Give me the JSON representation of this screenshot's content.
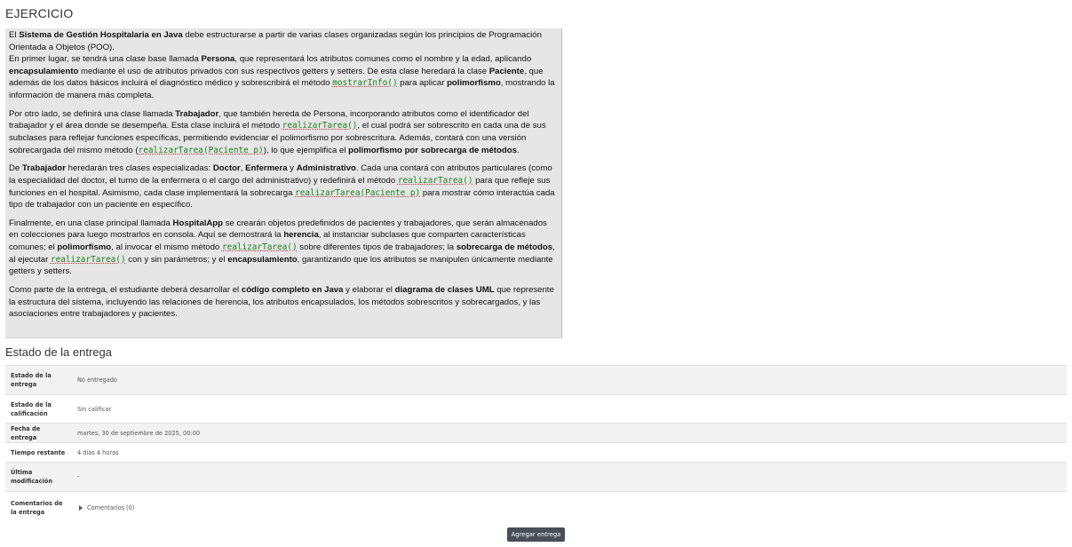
{
  "page": {
    "title": "EJERCICIO"
  },
  "exercise": {
    "p1": {
      "a": "El ",
      "b": "Sistema de Gestión Hospitalaria en Java",
      "c": " debe estructurarse a partir de varias clases organizadas según los principios de Programación Orientada a Objetos (POO).",
      "d": " En primer lugar, se tendrá una clase base llamada ",
      "e": "Persona",
      "f": ", que representará los atributos comunes como el nombre y la edad, aplicando ",
      "g": "encapsulamiento",
      "h": " mediante el uso de atributos privados con sus respectivos getters y setters. De esta clase heredará la clase ",
      "i": "Paciente",
      "j": ", que además de los datos básicos incluirá el diagnóstico médico y sobrescribirá el método ",
      "k": "mostrarInfo()",
      "l": " para aplicar ",
      "m": "polimorfismo",
      "n": ", mostrando la información de manera más completa."
    },
    "p2": {
      "a": "Por otro lado, se definirá una clase llamada ",
      "b": "Trabajador",
      "c": ", que también hereda de Persona, incorporando atributos como el identificador del trabajador y el área donde se desempeña. Esta clase incluirá el método ",
      "d": "realizarTarea()",
      "e": ", el cual podrá ser sobrescrito en cada una de sus subclases para reflejar funciones específicas, permitiendo evidenciar el polimorfismo por sobrescritura. Además, contará con una versión sobrecargada del mismo método (",
      "f": "realizarTarea(Paciente p)",
      "g": "), lo que ejemplifica el ",
      "h": "polimorfismo por sobrecarga de métodos",
      "i": "."
    },
    "p3": {
      "a": "De ",
      "b": "Trabajador",
      "c": " heredarán tres clases especializadas: ",
      "d": "Doctor",
      "e": ", ",
      "f": "Enfermera",
      "g": " y ",
      "h": "Administrativo",
      "i": ". Cada una contará con atributos particulares (como la especialidad del doctor, el turno de la enfermera o el cargo del administrativo) y redefinirá el método ",
      "j": "realizarTarea()",
      "k": " para que refleje sus funciones en el hospital. Asimismo, cada clase implementará la sobrecarga ",
      "l": "realizarTarea(Paciente p)",
      "m": " para mostrar cómo interactúa cada tipo de trabajador con un paciente en específico."
    },
    "p4": {
      "a": "Finalmente, en una clase principal llamada ",
      "b": "HospitalApp",
      "c": " se crearán objetos predefinidos de pacientes y trabajadores, que serán almacenados en colecciones para luego mostrarlos en consola. Aquí se demostrará la ",
      "d": "herencia",
      "e": ", al instanciar subclases que comparten características comunes; el ",
      "f": "polimorfismo",
      "g": ", al invocar el mismo método ",
      "h": "realizarTarea()",
      "i": " sobre diferentes tipos de trabajadores; la ",
      "j": "sobrecarga de métodos",
      "k": ", al ejecutar ",
      "l": "realizarTarea()",
      "m": " con y sin parámetros; y el ",
      "n": "encapsulamiento",
      "o": ", garantizando que los atributos se manipulen únicamente mediante getters y setters."
    },
    "p5": {
      "a": "Como parte de la entrega, el estudiante deberá desarrollar el ",
      "b": "código completo en Java",
      "c": " y elaborar el ",
      "d": "diagrama de clases UML",
      "e": " que represente la estructura del sistema, incluyendo las relaciones de herencia, los atributos encapsulados, los métodos sobrescritos y sobrecargados, y las asociaciones entre trabajadores y pacientes."
    }
  },
  "submission": {
    "title": "Estado de la entrega",
    "rows": [
      {
        "label": "Estado de la entrega",
        "value": "No entregado"
      },
      {
        "label": "Estado de la calificación",
        "value": "Sin calificar"
      },
      {
        "label": "Fecha de entrega",
        "value": "martes, 30 de septiembre de 2025, 00:00"
      },
      {
        "label": "Tiempo restante",
        "value": "4 días 4 horas"
      },
      {
        "label": "Última modificación",
        "value": "-"
      },
      {
        "label": "Comentarios de la entrega",
        "value": "Comentarios (0)"
      }
    ],
    "button": "Agregar entrega"
  }
}
